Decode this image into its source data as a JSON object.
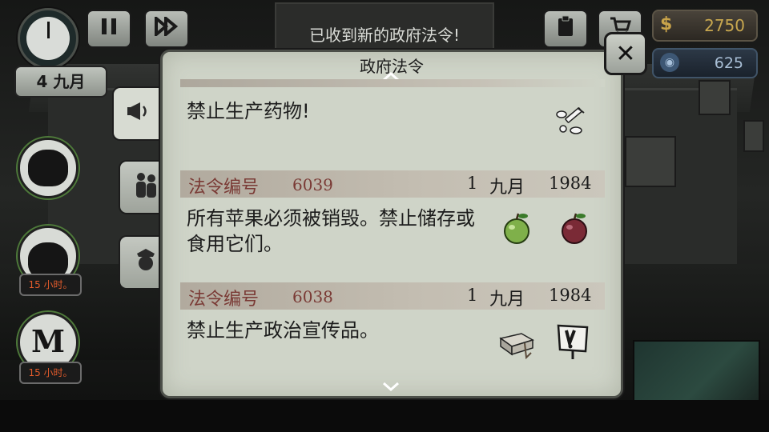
{
  "hud": {
    "date": "4 九月",
    "notification": "已收到新的政府法令!",
    "money": "2750",
    "money_symbol": "$",
    "reputation": "625",
    "pause_icon": "pause-icon",
    "fast_forward_icon": "fast-forward-icon",
    "clipboard_icon": "clipboard-icon",
    "cart_icon": "cart-icon"
  },
  "portraits": [
    {
      "name": "character-1",
      "timer": ""
    },
    {
      "name": "character-2",
      "timer": "15 小时。"
    },
    {
      "name": "character-3",
      "timer": "15 小时。"
    }
  ],
  "tabs": [
    {
      "name": "decrees-tab",
      "icon": "megaphone-icon",
      "active": true
    },
    {
      "name": "family-tab",
      "icon": "people-icon",
      "active": false
    },
    {
      "name": "officer-tab",
      "icon": "officer-icon",
      "active": false
    }
  ],
  "panel": {
    "title": "政府法令",
    "close_symbol": "✕",
    "decrees": [
      {
        "label": "",
        "number": "",
        "day": "",
        "month": "",
        "year": "",
        "text": "禁止生产药物!",
        "icons": [
          "medicine-icon"
        ]
      },
      {
        "label": "法令编号",
        "number": "6039",
        "day": "1",
        "month": "九月",
        "year": "1984",
        "text": "所有苹果必须被销毁。禁止储存或食用它们。",
        "icons": [
          "green-apple-icon",
          "red-apple-icon"
        ]
      },
      {
        "label": "法令编号",
        "number": "6038",
        "day": "1",
        "month": "九月",
        "year": "1984",
        "text": "禁止生产政治宣传品。",
        "icons": [
          "propaganda-bundle-icon",
          "warning-sign-icon"
        ]
      }
    ]
  },
  "colors": {
    "panel_bg": "#cfd4c8",
    "decree_label": "#7a3a35",
    "timer_text": "#e25b2b",
    "money_text": "#c8a74f",
    "reputation_text": "#a9bfd6"
  }
}
